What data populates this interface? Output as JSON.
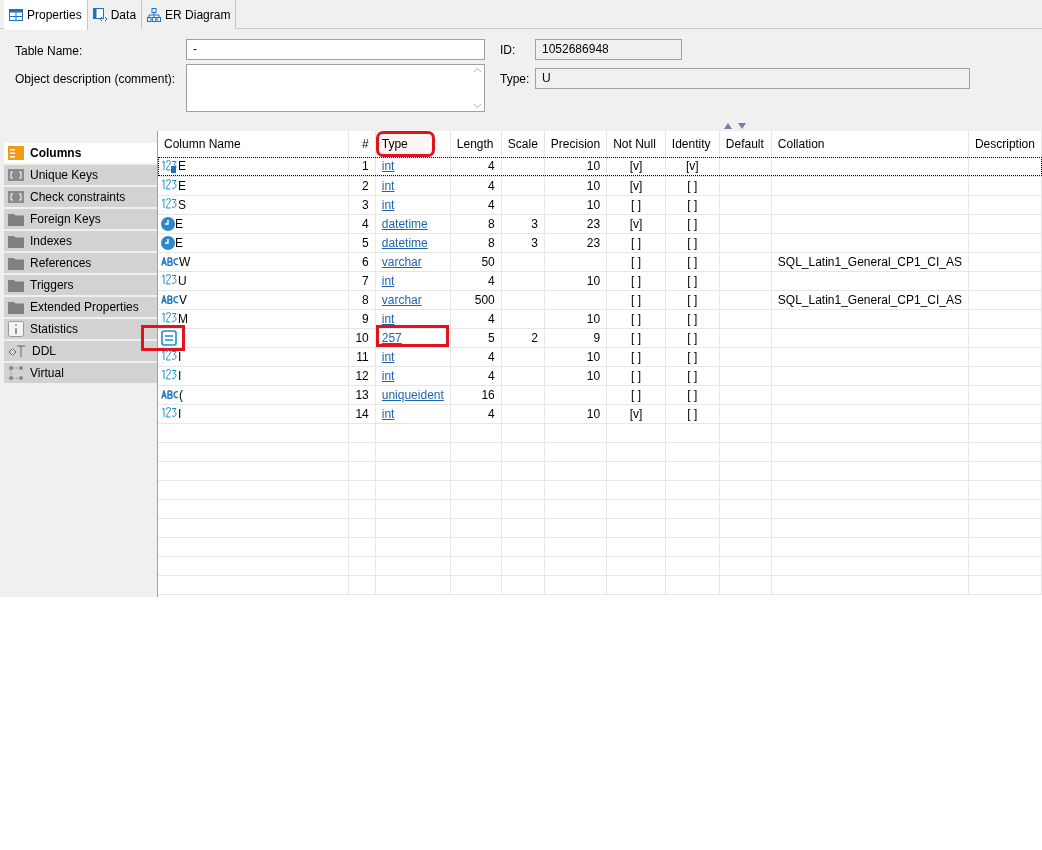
{
  "tabs": [
    {
      "label": "Properties",
      "selected": true
    },
    {
      "label": "Data",
      "selected": false
    },
    {
      "label": "ER Diagram",
      "selected": false
    }
  ],
  "form": {
    "table_name_label": "Table Name:",
    "table_name": "-",
    "description_label": "Object description (comment):",
    "id_label": "ID:",
    "id": "1052686948",
    "type_label": "Type:",
    "type": "U"
  },
  "sidebar": [
    {
      "label": "Columns",
      "selected": true
    },
    {
      "label": "Unique Keys",
      "selected": false
    },
    {
      "label": "Check constraints",
      "selected": false
    },
    {
      "label": "Foreign Keys",
      "selected": false
    },
    {
      "label": "Indexes",
      "selected": false
    },
    {
      "label": "References",
      "selected": false
    },
    {
      "label": "Triggers",
      "selected": false
    },
    {
      "label": "Extended Properties",
      "selected": false
    },
    {
      "label": "Statistics",
      "selected": false
    },
    {
      "label": "DDL",
      "selected": false
    },
    {
      "label": "Virtual",
      "selected": false
    }
  ],
  "table": {
    "columns": [
      {
        "label": "Column Name",
        "highlighted": false
      },
      {
        "label": "#",
        "highlighted": false
      },
      {
        "label": "Type",
        "highlighted": true
      },
      {
        "label": "Length",
        "highlighted": false
      },
      {
        "label": "Scale",
        "highlighted": false
      },
      {
        "label": "Precision",
        "highlighted": false
      },
      {
        "label": "Not Null",
        "highlighted": false
      },
      {
        "label": "Identity",
        "highlighted": false
      },
      {
        "label": "Default",
        "highlighted": false
      },
      {
        "label": "Collation",
        "highlighted": false
      },
      {
        "label": "Description",
        "highlighted": false
      }
    ],
    "rows": [
      {
        "kind": "number",
        "key": true,
        "name": "E",
        "num": "1",
        "type": "int",
        "length": "4",
        "scale": "",
        "precision": "10",
        "not_null": "[v]",
        "identity": "[v]",
        "collation": "",
        "focused": true,
        "highlighted": false
      },
      {
        "kind": "number",
        "key": false,
        "name": "E",
        "num": "2",
        "type": "int",
        "length": "4",
        "scale": "",
        "precision": "10",
        "not_null": "[v]",
        "identity": "[ ]",
        "collation": "",
        "focused": false,
        "highlighted": false
      },
      {
        "kind": "number",
        "key": false,
        "name": "S",
        "num": "3",
        "type": "int",
        "length": "4",
        "scale": "",
        "precision": "10",
        "not_null": "[ ]",
        "identity": "[ ]",
        "collation": "",
        "focused": false,
        "highlighted": false
      },
      {
        "kind": "date",
        "key": false,
        "name": "E",
        "num": "4",
        "type": "datetime",
        "length": "8",
        "scale": "3",
        "precision": "23",
        "not_null": "[v]",
        "identity": "[ ]",
        "collation": "",
        "focused": false,
        "highlighted": false
      },
      {
        "kind": "date",
        "key": false,
        "name": "E",
        "num": "5",
        "type": "datetime",
        "length": "8",
        "scale": "3",
        "precision": "23",
        "not_null": "[ ]",
        "identity": "[ ]",
        "collation": "",
        "focused": false,
        "highlighted": false
      },
      {
        "kind": "text",
        "key": false,
        "name": "W",
        "num": "6",
        "type": "varchar",
        "length": "50",
        "scale": "",
        "precision": "",
        "not_null": "[ ]",
        "identity": "[ ]",
        "collation": "SQL_Latin1_General_CP1_CI_AS",
        "focused": false,
        "highlighted": false
      },
      {
        "kind": "number",
        "key": false,
        "name": "U",
        "num": "7",
        "type": "int",
        "length": "4",
        "scale": "",
        "precision": "10",
        "not_null": "[ ]",
        "identity": "[ ]",
        "collation": "",
        "focused": false,
        "highlighted": false
      },
      {
        "kind": "text",
        "key": false,
        "name": "V",
        "num": "8",
        "type": "varchar",
        "length": "500",
        "scale": "",
        "precision": "",
        "not_null": "[ ]",
        "identity": "[ ]",
        "collation": "SQL_Latin1_General_CP1_CI_AS",
        "focused": false,
        "highlighted": false
      },
      {
        "kind": "number",
        "key": false,
        "name": "M",
        "num": "9",
        "type": "int",
        "length": "4",
        "scale": "",
        "precision": "10",
        "not_null": "[ ]",
        "identity": "[ ]",
        "collation": "",
        "focused": false,
        "highlighted": false
      },
      {
        "kind": "custom",
        "key": false,
        "name": "",
        "num": "10",
        "type": "257",
        "length": "5",
        "scale": "2",
        "precision": "9",
        "not_null": "[ ]",
        "identity": "[ ]",
        "collation": "",
        "focused": false,
        "highlighted": true
      },
      {
        "kind": "number",
        "key": false,
        "name": "I",
        "num": "11",
        "type": "int",
        "length": "4",
        "scale": "",
        "precision": "10",
        "not_null": "[ ]",
        "identity": "[ ]",
        "collation": "",
        "focused": false,
        "highlighted": false
      },
      {
        "kind": "number",
        "key": false,
        "name": "I",
        "num": "12",
        "type": "int",
        "length": "4",
        "scale": "",
        "precision": "10",
        "not_null": "[ ]",
        "identity": "[ ]",
        "collation": "",
        "focused": false,
        "highlighted": false
      },
      {
        "kind": "text",
        "key": false,
        "name": "(",
        "num": "13",
        "type": "uniqueident",
        "length": "16",
        "scale": "",
        "precision": "",
        "not_null": "[ ]",
        "identity": "[ ]",
        "collation": "",
        "focused": false,
        "highlighted": false
      },
      {
        "kind": "number",
        "key": false,
        "name": "I",
        "num": "14",
        "type": "int",
        "length": "4",
        "scale": "",
        "precision": "10",
        "not_null": "[v]",
        "identity": "[ ]",
        "collation": "",
        "focused": false,
        "highlighted": false
      }
    ]
  }
}
